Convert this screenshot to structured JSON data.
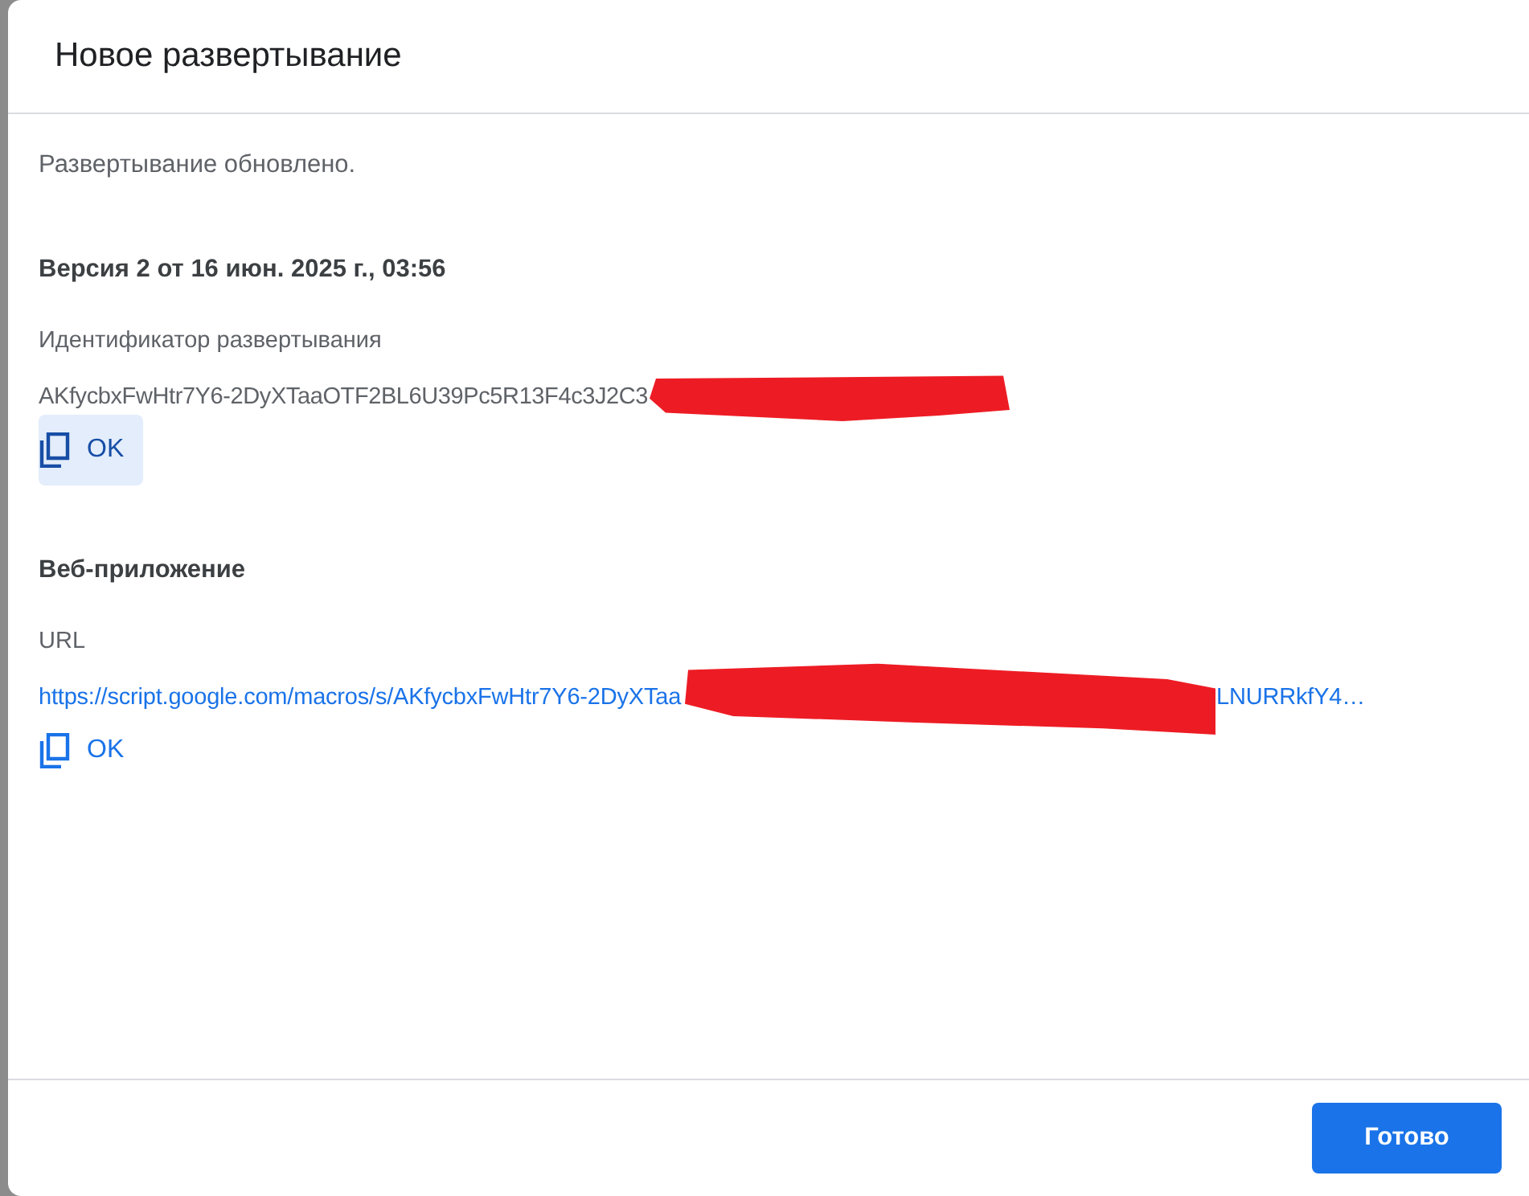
{
  "dialog": {
    "title": "Новое развертывание"
  },
  "status": "Развертывание обновлено.",
  "version": "Версия 2 от 16 июн. 2025 г., 03:56",
  "deployment_id": {
    "label": "Идентификатор развертывания",
    "value_start": "AKfycbxFwHtr7Y6-2DyXTaaOTF2BL6U39Pc5R13F4c3J2C3",
    "copy_button": {
      "label": "OK",
      "focused": true
    }
  },
  "web_app": {
    "heading": "Веб-приложение",
    "label": "URL",
    "url_start": "https://script.google.com/macros/s/AKfycbxFwHtr7Y6-2DyXTaa",
    "url_end": "LNURRkfY4…",
    "copy_button": {
      "label": "OK",
      "focused": false
    }
  },
  "footer": {
    "done_button": "Готово"
  }
}
